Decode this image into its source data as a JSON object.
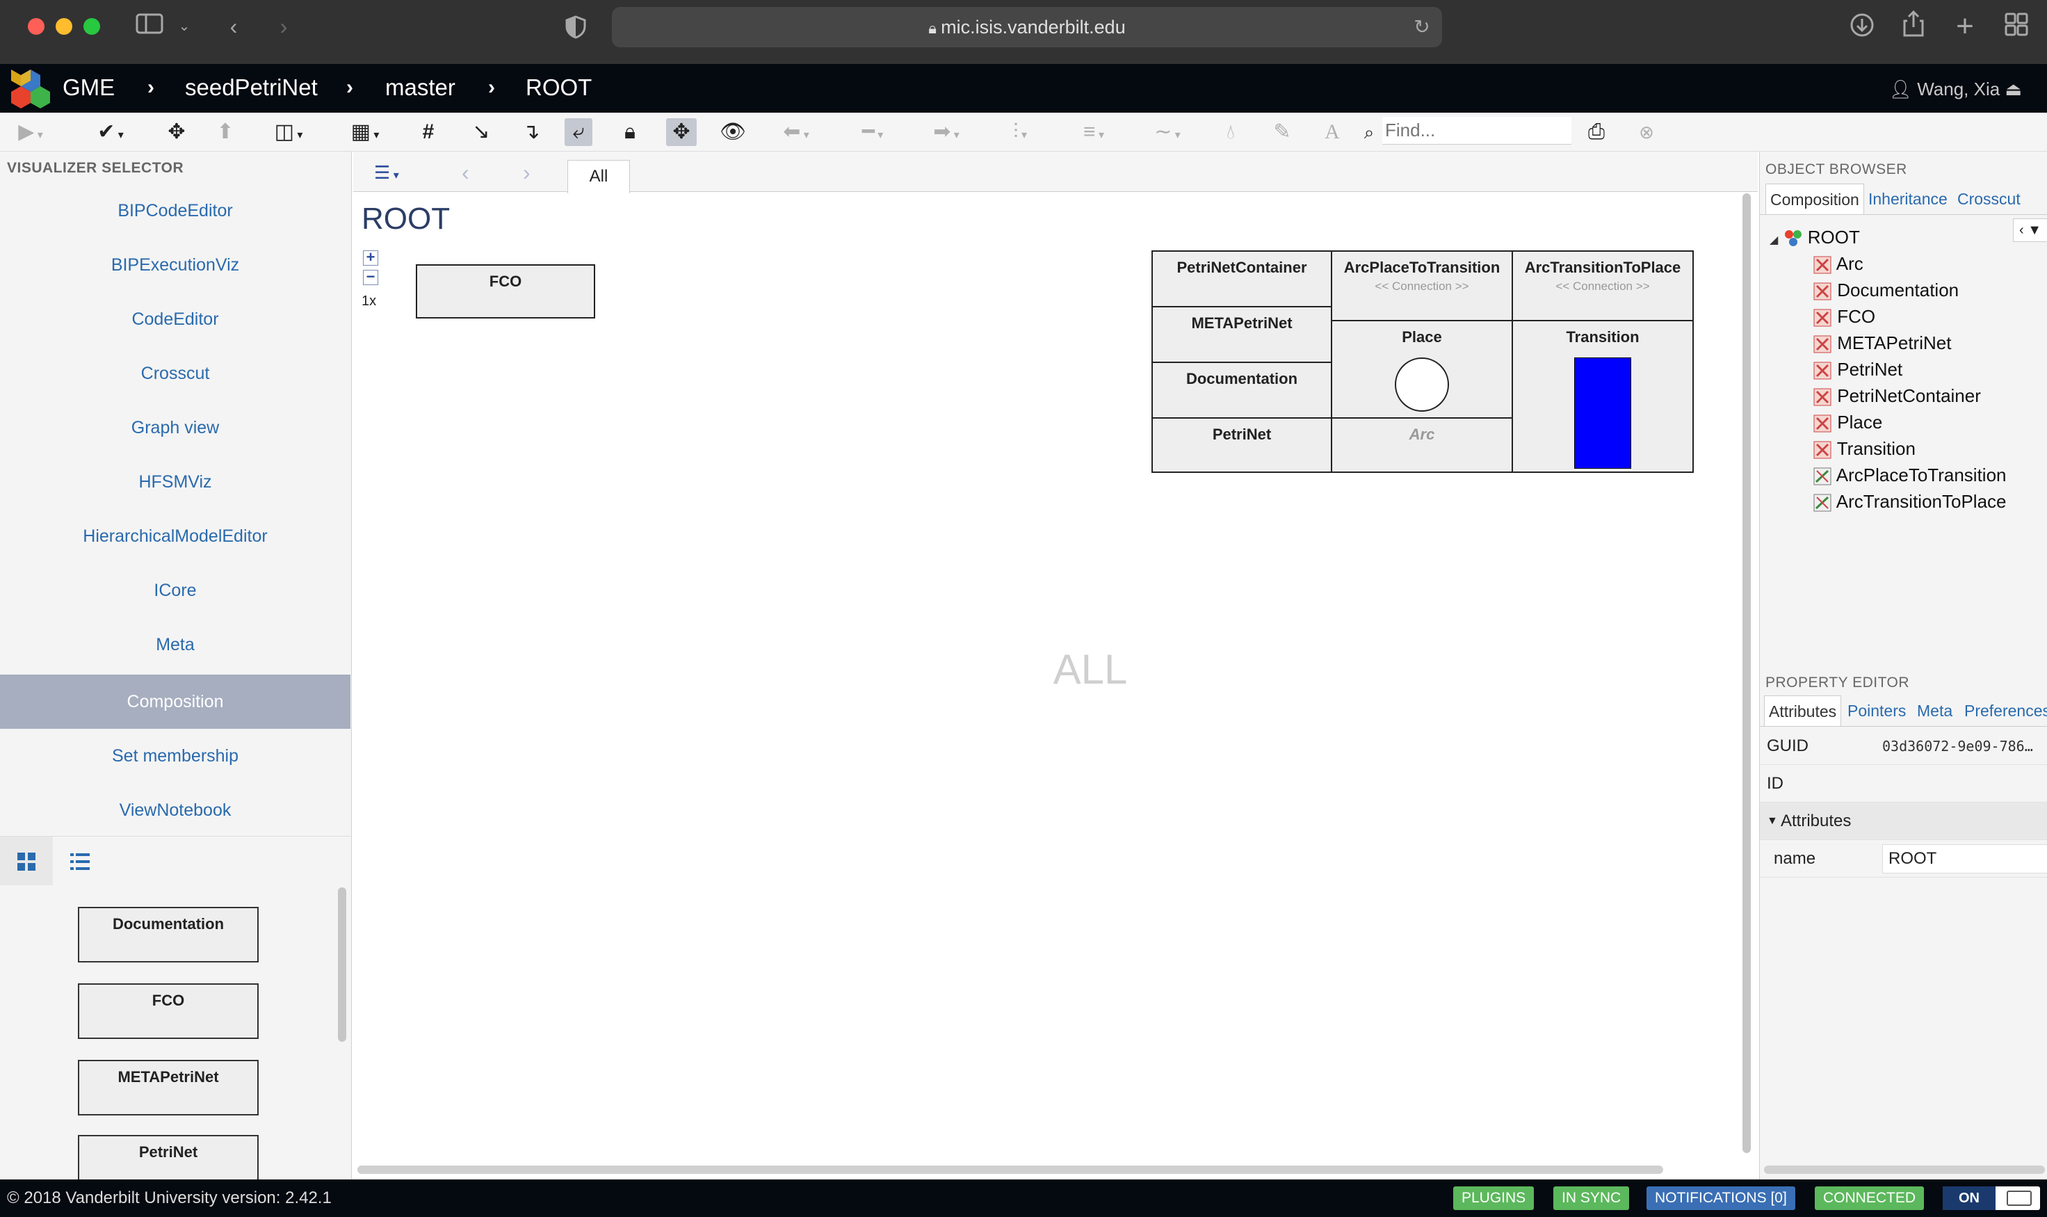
{
  "browser": {
    "url": "mic.isis.vanderbilt.edu"
  },
  "navbar": {
    "app_name": "GME",
    "breadcrumbs": [
      "seedPetriNet",
      "master",
      "ROOT"
    ],
    "user": "Wang, Xia"
  },
  "toolbar": {
    "find_placeholder": "Find..."
  },
  "visualizer_selector": {
    "title": "VISUALIZER SELECTOR",
    "items": [
      {
        "label": "BIPCodeEditor"
      },
      {
        "label": "BIPExecutionViz"
      },
      {
        "label": "CodeEditor"
      },
      {
        "label": "Crosscut"
      },
      {
        "label": "Graph view"
      },
      {
        "label": "HFSMViz"
      },
      {
        "label": "HierarchicalModelEditor"
      },
      {
        "label": "ICore"
      },
      {
        "label": "Meta"
      },
      {
        "label": "Composition"
      },
      {
        "label": "Set membership"
      },
      {
        "label": "ViewNotebook"
      }
    ],
    "active": "Composition"
  },
  "part_browser": {
    "items": [
      {
        "label": "Documentation"
      },
      {
        "label": "FCO"
      },
      {
        "label": "METAPetriNet"
      },
      {
        "label": "PetriNet"
      }
    ]
  },
  "center": {
    "tab_label": "All",
    "title": "ROOT",
    "zoom_label": "1x",
    "watermark": "ALL",
    "fco_box": "FCO",
    "meta_sheet": {
      "col1": [
        "PetriNetContainer",
        "METAPetriNet",
        "Documentation",
        "PetriNet"
      ],
      "arc_place_to_transition": "ArcPlaceToTransition",
      "arc_transition_to_place": "ArcTransitionToPlace",
      "connection_label": "<< Connection >>",
      "place": "Place",
      "transition": "Transition",
      "arc": "Arc"
    }
  },
  "object_browser": {
    "title": "OBJECT BROWSER",
    "tabs": [
      "Composition",
      "Inheritance",
      "Crosscut"
    ],
    "tree": {
      "root": "ROOT",
      "children": [
        {
          "label": "Arc",
          "icon": "meta-node-icon"
        },
        {
          "label": "Documentation",
          "icon": "meta-node-icon"
        },
        {
          "label": "FCO",
          "icon": "meta-node-icon"
        },
        {
          "label": "METAPetriNet",
          "icon": "meta-node-icon"
        },
        {
          "label": "PetriNet",
          "icon": "meta-node-icon"
        },
        {
          "label": "PetriNetContainer",
          "icon": "meta-node-icon"
        },
        {
          "label": "Place",
          "icon": "meta-node-icon"
        },
        {
          "label": "Transition",
          "icon": "meta-node-icon"
        },
        {
          "label": "ArcPlaceToTransition",
          "icon": "connection-node-icon"
        },
        {
          "label": "ArcTransitionToPlace",
          "icon": "connection-node-icon"
        }
      ]
    }
  },
  "property_editor": {
    "title": "PROPERTY EDITOR",
    "tabs": [
      "Attributes",
      "Pointers",
      "Meta",
      "Preferences"
    ],
    "guid_label": "GUID",
    "guid_value": "03d36072-9e09-786…",
    "id_label": "ID",
    "section": "Attributes",
    "name_label": "name",
    "name_value": "ROOT"
  },
  "footer": {
    "copyright": "© 2018 Vanderbilt University",
    "version": "version: 2.42.1",
    "badges": [
      {
        "label": "PLUGINS",
        "color": "#5cb85c"
      },
      {
        "label": "IN SYNC",
        "color": "#5cb85c"
      },
      {
        "label": "NOTIFICATIONS [0]",
        "color": "#3a6fb5"
      },
      {
        "label": "CONNECTED",
        "color": "#5cb85c"
      }
    ],
    "toggle": "ON"
  },
  "colors": {
    "accent_blue": "#2a6aad",
    "transition_fill": "#0000ff",
    "active_viz": "#a6aebf"
  }
}
